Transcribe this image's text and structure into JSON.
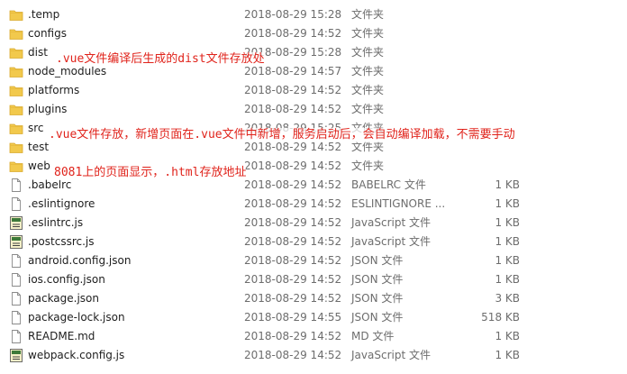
{
  "files": [
    {
      "name": ".temp",
      "date": "2018-08-29 15:28",
      "type": "文件夹",
      "size": "",
      "icon": "folder-icon"
    },
    {
      "name": "configs",
      "date": "2018-08-29 14:52",
      "type": "文件夹",
      "size": "",
      "icon": "folder-icon"
    },
    {
      "name": "dist",
      "date": "2018-08-29 15:28",
      "type": "文件夹",
      "size": "",
      "icon": "folder-icon"
    },
    {
      "name": "node_modules",
      "date": "2018-08-29 14:57",
      "type": "文件夹",
      "size": "",
      "icon": "folder-icon"
    },
    {
      "name": "platforms",
      "date": "2018-08-29 14:52",
      "type": "文件夹",
      "size": "",
      "icon": "folder-icon"
    },
    {
      "name": "plugins",
      "date": "2018-08-29 14:52",
      "type": "文件夹",
      "size": "",
      "icon": "folder-icon"
    },
    {
      "name": "src",
      "date": "2018-08-29 15:25",
      "type": "文件夹",
      "size": "",
      "icon": "folder-icon"
    },
    {
      "name": "test",
      "date": "2018-08-29 14:52",
      "type": "文件夹",
      "size": "",
      "icon": "folder-icon"
    },
    {
      "name": "web",
      "date": "2018-08-29 14:52",
      "type": "文件夹",
      "size": "",
      "icon": "folder-icon"
    },
    {
      "name": ".babelrc",
      "date": "2018-08-29 14:52",
      "type": "BABELRC 文件",
      "size": "1 KB",
      "icon": "file-icon"
    },
    {
      "name": ".eslintignore",
      "date": "2018-08-29 14:52",
      "type": "ESLINTIGNORE ...",
      "size": "1 KB",
      "icon": "file-icon"
    },
    {
      "name": ".eslintrc.js",
      "date": "2018-08-29 14:52",
      "type": "JavaScript 文件",
      "size": "1 KB",
      "icon": "js-file-icon"
    },
    {
      "name": ".postcssrc.js",
      "date": "2018-08-29 14:52",
      "type": "JavaScript 文件",
      "size": "1 KB",
      "icon": "js-file-icon"
    },
    {
      "name": "android.config.json",
      "date": "2018-08-29 14:52",
      "type": "JSON 文件",
      "size": "1 KB",
      "icon": "file-icon"
    },
    {
      "name": "ios.config.json",
      "date": "2018-08-29 14:52",
      "type": "JSON 文件",
      "size": "1 KB",
      "icon": "file-icon"
    },
    {
      "name": "package.json",
      "date": "2018-08-29 14:52",
      "type": "JSON 文件",
      "size": "3 KB",
      "icon": "file-icon"
    },
    {
      "name": "package-lock.json",
      "date": "2018-08-29 14:55",
      "type": "JSON 文件",
      "size": "518 KB",
      "icon": "file-icon"
    },
    {
      "name": "README.md",
      "date": "2018-08-29 14:52",
      "type": "MD 文件",
      "size": "1 KB",
      "icon": "file-icon"
    },
    {
      "name": "webpack.config.js",
      "date": "2018-08-29 14:52",
      "type": "JavaScript 文件",
      "size": "1 KB",
      "icon": "js-file-icon"
    }
  ],
  "annotations": {
    "dist_note": ".vue文件编译后生成的dist文件存放处",
    "src_note": ".vue文件存放，新增页面在.vue文件中新增，服务启动后，会自动编译加载，不需要手动",
    "web_note": "8081上的页面显示，.html存放地址"
  },
  "colors": {
    "folder": "#f2c94c",
    "annotation": "#e0231b",
    "meta_text": "#6d6d6d"
  }
}
